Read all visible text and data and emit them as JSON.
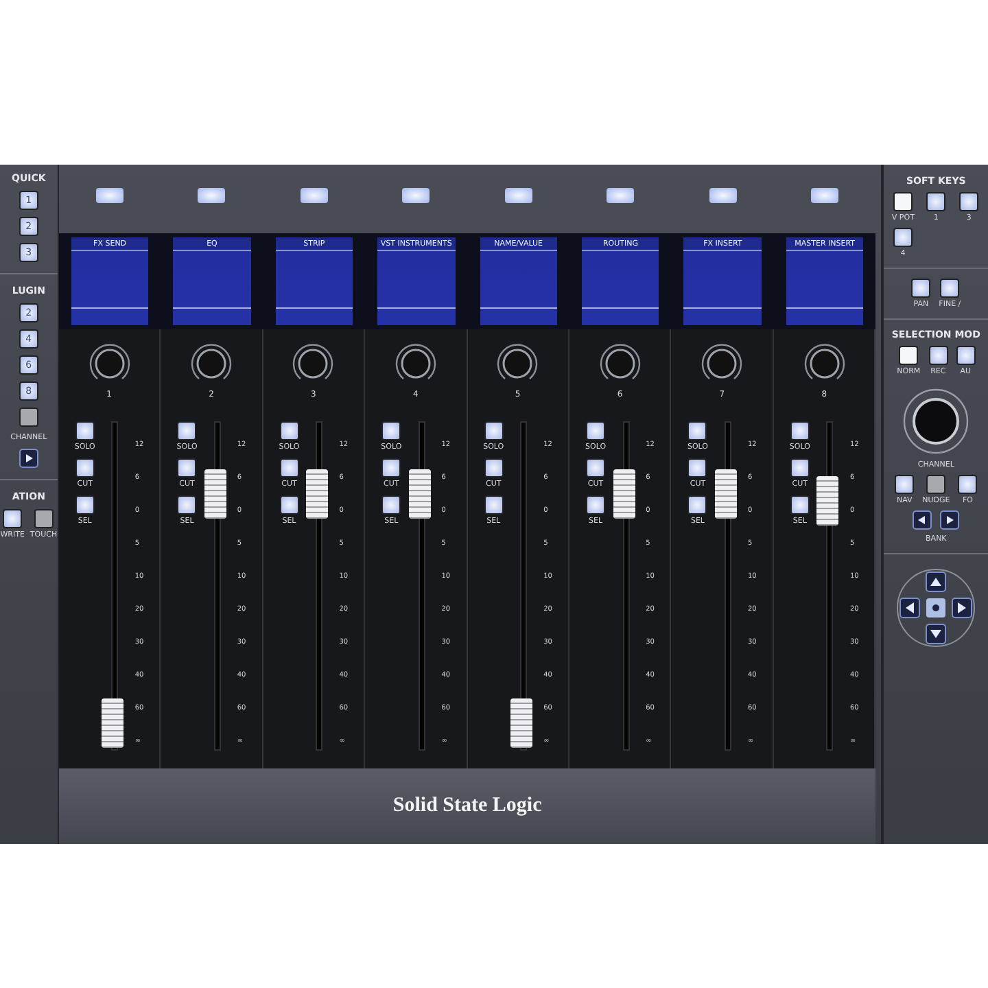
{
  "left_panel": {
    "quick_title": "QUICK",
    "quick_keys": [
      "1",
      "2",
      "3"
    ],
    "plugin_title": "LUGIN",
    "plugin_keys": [
      "2",
      "4",
      "6",
      "8"
    ],
    "channel_label": "CHANNEL",
    "automation_title": "ATION",
    "automation_keys": [
      "WRITE",
      "TOUCH"
    ]
  },
  "channels": [
    {
      "display_title": "FX SEND",
      "number": "1",
      "buttons": [
        "SOLO",
        "CUT",
        "SEL"
      ],
      "scale": [
        "12",
        "6",
        "0",
        "5",
        "10",
        "20",
        "30",
        "40",
        "60",
        "∞"
      ],
      "level": 0.08
    },
    {
      "display_title": "EQ",
      "number": "2",
      "buttons": [
        "SOLO",
        "CUT",
        "SEL"
      ],
      "scale": [
        "12",
        "6",
        "0",
        "5",
        "10",
        "20",
        "30",
        "40",
        "60",
        "∞"
      ],
      "level": 0.78
    },
    {
      "display_title": "STRIP",
      "number": "3",
      "buttons": [
        "SOLO",
        "CUT",
        "SEL"
      ],
      "scale": [
        "12",
        "6",
        "0",
        "5",
        "10",
        "20",
        "30",
        "40",
        "60",
        "∞"
      ],
      "level": 0.78
    },
    {
      "display_title": "VST INSTRUMENTS",
      "number": "4",
      "buttons": [
        "SOLO",
        "CUT",
        "SEL"
      ],
      "scale": [
        "12",
        "6",
        "0",
        "5",
        "10",
        "20",
        "30",
        "40",
        "60",
        "∞"
      ],
      "level": 0.78
    },
    {
      "display_title": "NAME/VALUE",
      "number": "5",
      "buttons": [
        "SOLO",
        "CUT",
        "SEL"
      ],
      "scale": [
        "12",
        "6",
        "0",
        "5",
        "10",
        "20",
        "30",
        "40",
        "60",
        "∞"
      ],
      "level": 0.08
    },
    {
      "display_title": "ROUTING",
      "number": "6",
      "buttons": [
        "SOLO",
        "CUT",
        "SEL"
      ],
      "scale": [
        "12",
        "6",
        "0",
        "5",
        "10",
        "20",
        "30",
        "40",
        "60",
        "∞"
      ],
      "level": 0.78
    },
    {
      "display_title": "FX INSERT",
      "number": "7",
      "buttons": [
        "SOLO",
        "CUT",
        "SEL"
      ],
      "scale": [
        "12",
        "6",
        "0",
        "5",
        "10",
        "20",
        "30",
        "40",
        "60",
        "∞"
      ],
      "level": 0.78
    },
    {
      "display_title": "MASTER INSERT",
      "number": "8",
      "buttons": [
        "SOLO",
        "CUT",
        "SEL"
      ],
      "scale": [
        "12",
        "6",
        "0",
        "5",
        "10",
        "20",
        "30",
        "40",
        "60",
        "∞"
      ],
      "level": 0.76
    }
  ],
  "brand": "Solid State Logic",
  "right_panel": {
    "soft_keys_title": "SOFT KEYS",
    "soft_keys": [
      "V POT",
      "1",
      "3",
      "4"
    ],
    "pan_keys": [
      "PAN",
      "FINE /"
    ],
    "selection_title": "SELECTION MOD",
    "selection_keys": [
      "NORM",
      "REC",
      "AU"
    ],
    "jog_label": "CHANNEL",
    "nav_keys": [
      "NAV",
      "NUDGE",
      "FO"
    ],
    "bank_label": "BANK"
  }
}
